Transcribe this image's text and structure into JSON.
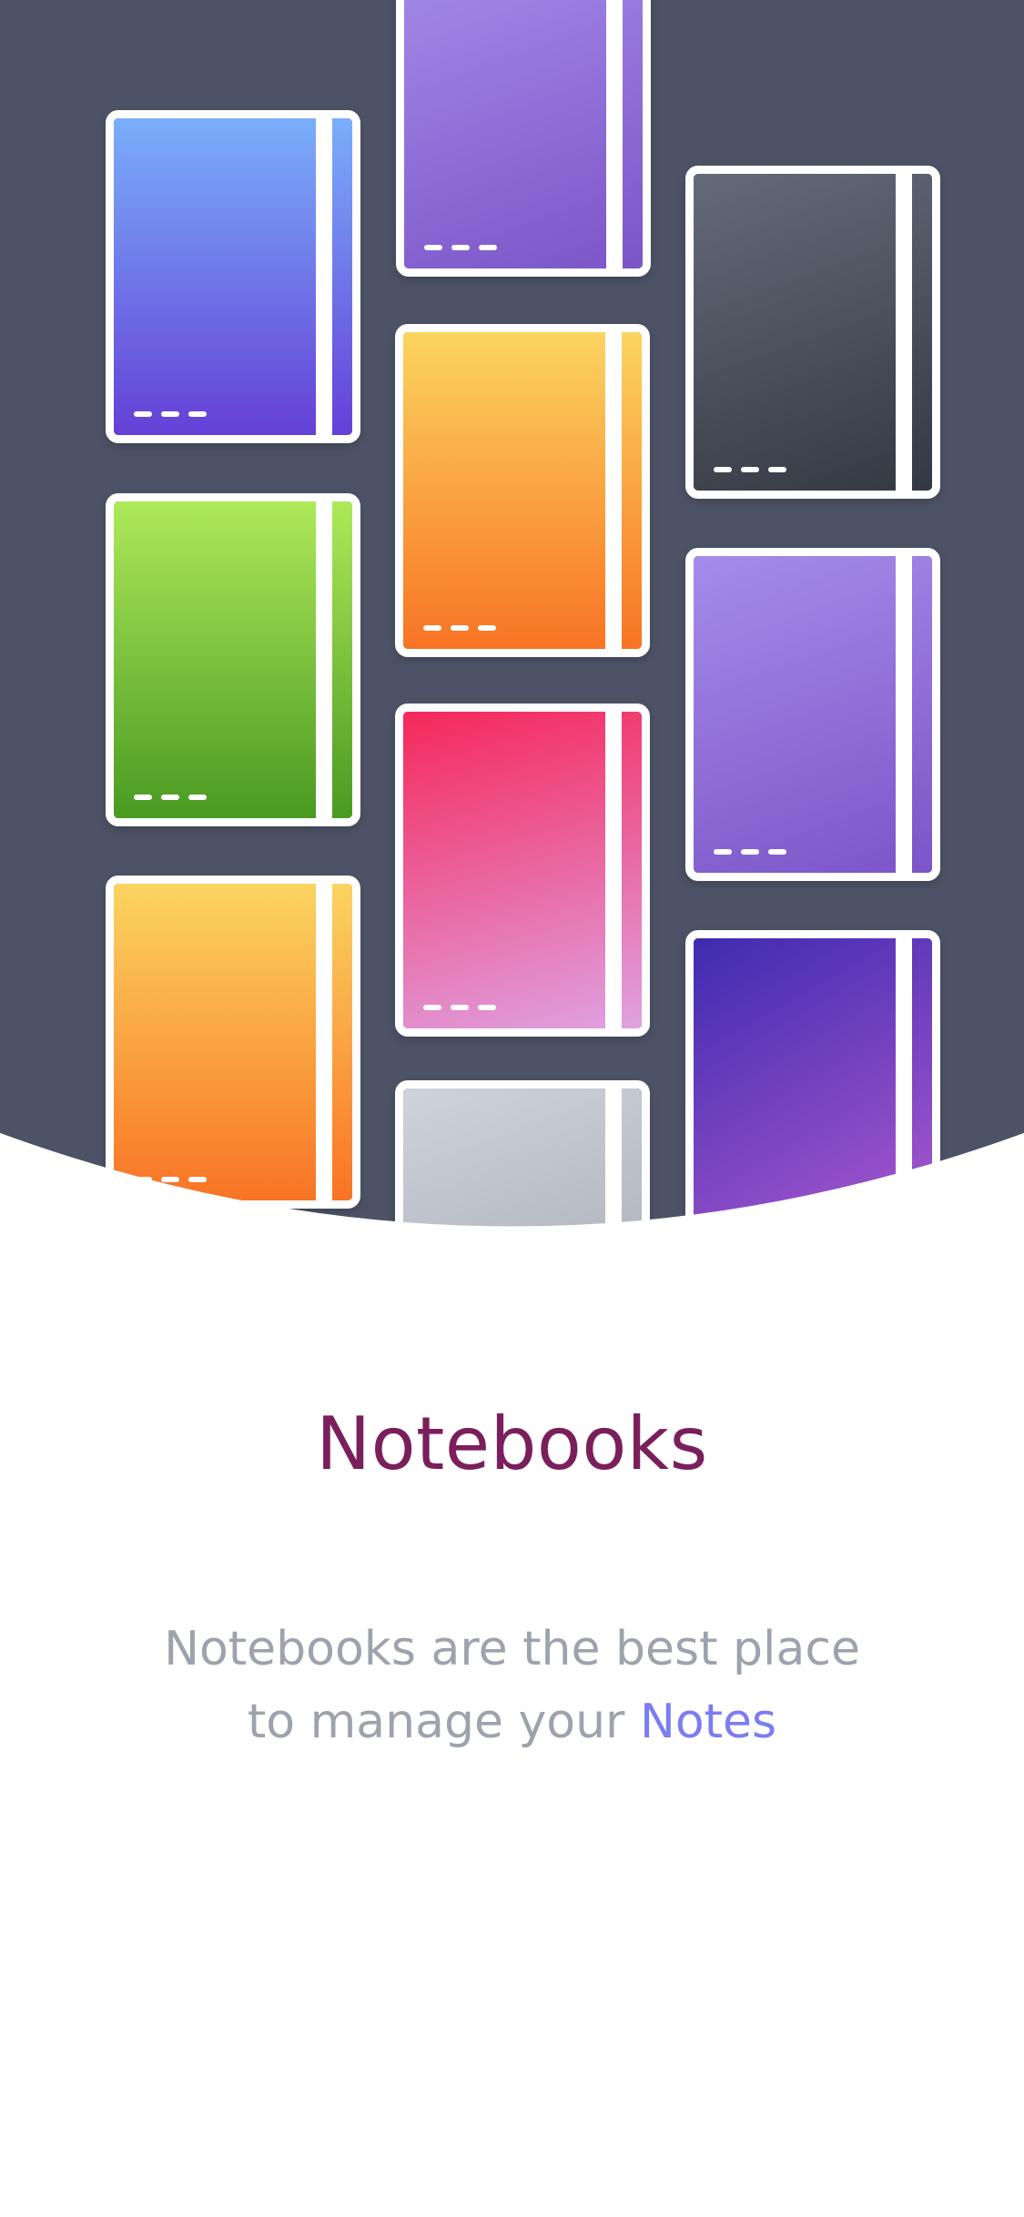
{
  "onboarding": {
    "title": "Notebooks",
    "description_line1": "Notebooks are the best place",
    "description_line2_prefix": "to manage your ",
    "description_highlight": "Notes"
  },
  "colors": {
    "hero_background": "#4d5366",
    "title": "#7a1f5c",
    "description": "#9ea2ad",
    "highlight": "#7b7df2",
    "notebook_gradients": [
      [
        "#7aaefa",
        "#6540d6"
      ],
      [
        "#a68ce9",
        "#7b55c8"
      ],
      [
        "#646b78",
        "#343843"
      ],
      [
        "#fbd461",
        "#f87424"
      ],
      [
        "#aee95a",
        "#4a9a22"
      ],
      [
        "#a68ce9",
        "#7b55c8"
      ],
      [
        "#f5285b",
        "#dfa2e2"
      ],
      [
        "#fbd461",
        "#f87424"
      ],
      [
        "#cfd3da",
        "#9ea4af"
      ],
      [
        "#3e2bb0",
        "#b05bd0"
      ]
    ]
  }
}
